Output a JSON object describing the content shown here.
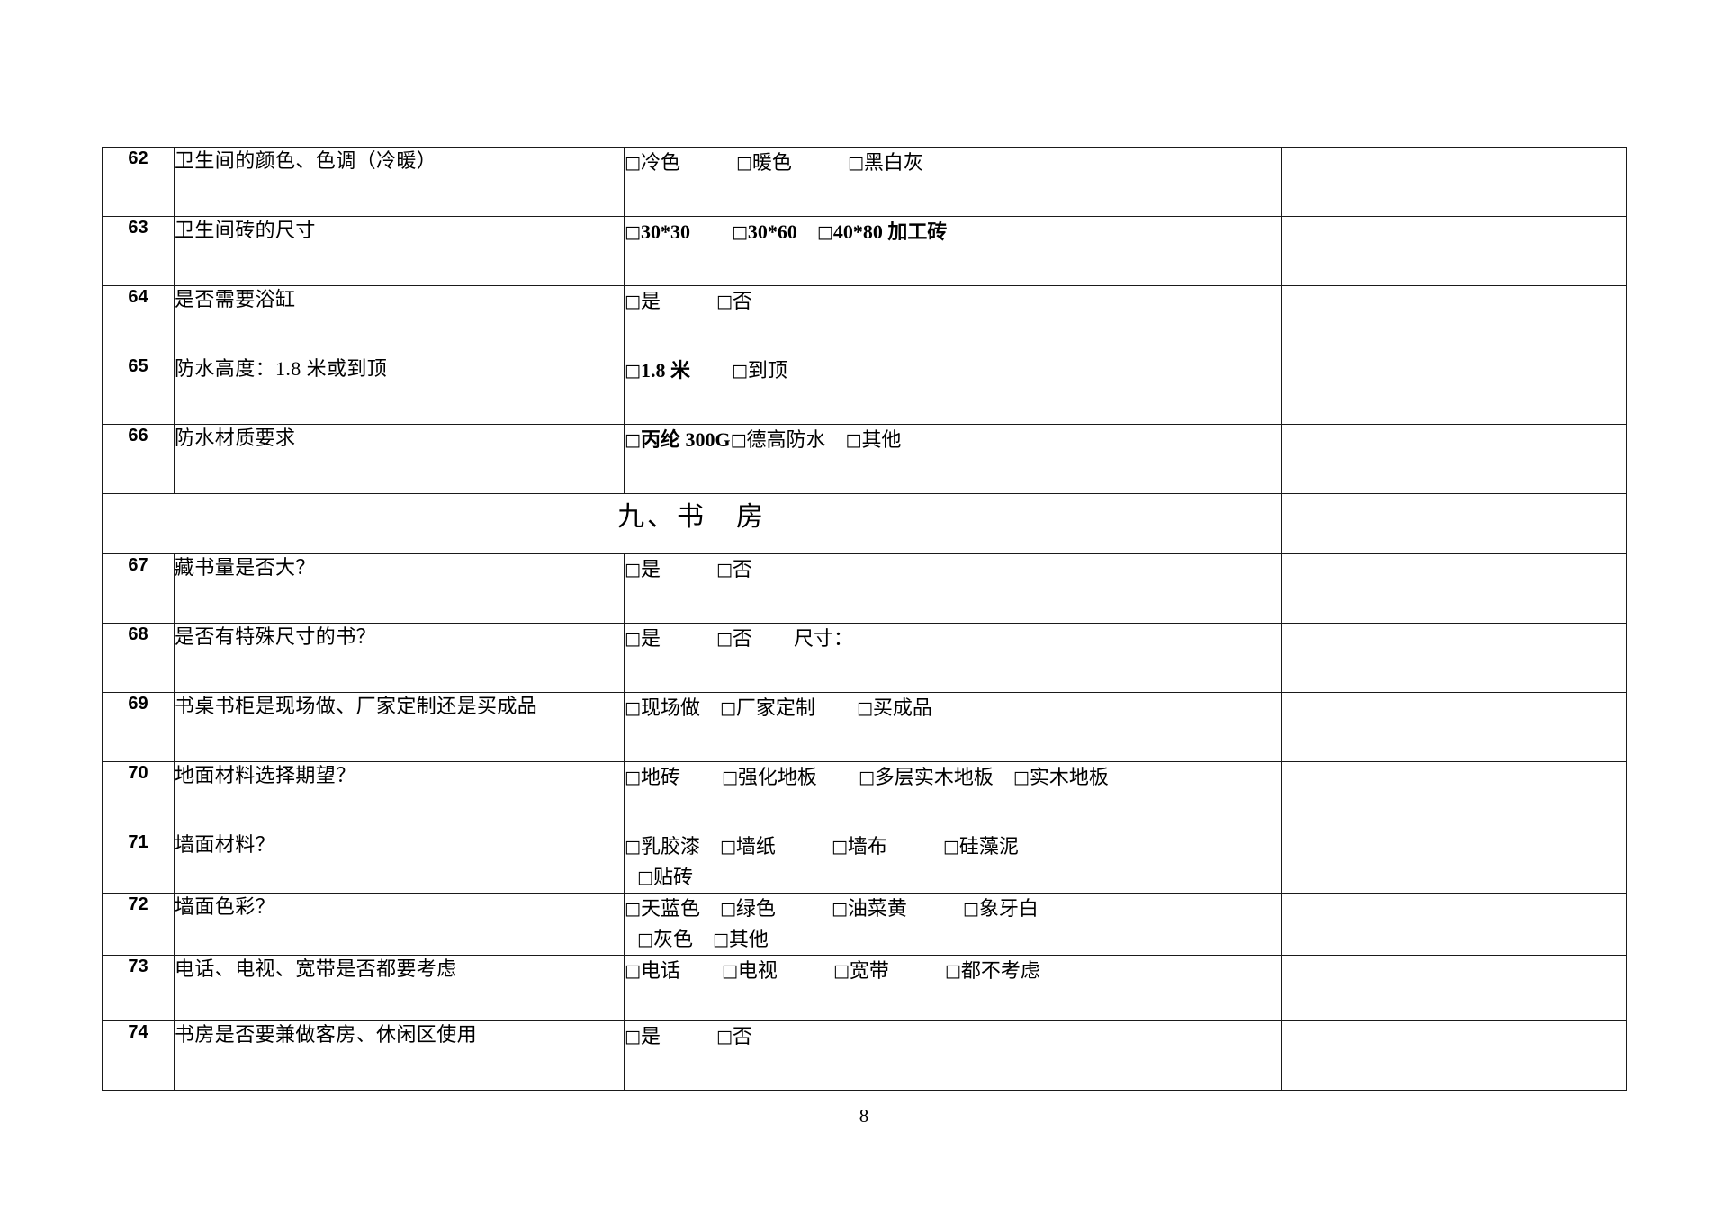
{
  "document": {
    "page_number": "8",
    "checkbox_glyph": "□"
  },
  "table": {
    "rows": [
      {
        "kind": "question",
        "number": "62",
        "question": "卫生间的颜色、色调（冷暖）",
        "option_lines": [
          [
            {
              "label": "冷色",
              "bold": false,
              "gap": "lg"
            },
            {
              "label": "暖色",
              "bold": false,
              "gap": "lg"
            },
            {
              "label": "黑白灰",
              "bold": false,
              "gap": "none"
            }
          ]
        ],
        "note": "",
        "height": "tall"
      },
      {
        "kind": "question",
        "number": "63",
        "question": "卫生间砖的尺寸",
        "option_lines": [
          [
            {
              "label": "30*30",
              "bold": true,
              "gap": "md"
            },
            {
              "label": "30*60",
              "bold": true,
              "gap": "sm"
            },
            {
              "label": "40*80 加工砖",
              "bold": true,
              "gap": "none"
            }
          ]
        ],
        "note": "",
        "height": "tall"
      },
      {
        "kind": "question",
        "number": "64",
        "question": "是否需要浴缸",
        "option_lines": [
          [
            {
              "label": "是",
              "bold": false,
              "gap": "lg"
            },
            {
              "label": "否",
              "bold": false,
              "gap": "none"
            }
          ]
        ],
        "note": "",
        "height": "tall"
      },
      {
        "kind": "question",
        "number": "65",
        "question": "防水高度：1.8 米或到顶",
        "option_lines": [
          [
            {
              "label": "1.8 米",
              "bold": true,
              "gap": "md"
            },
            {
              "label": "到顶",
              "bold": false,
              "gap": "none"
            }
          ]
        ],
        "note": "",
        "height": "tall"
      },
      {
        "kind": "question",
        "number": "66",
        "question": "防水材质要求",
        "option_lines": [
          [
            {
              "label": "丙纶 300G",
              "bold": true,
              "gap": "none"
            },
            {
              "label": "德高防水",
              "bold": false,
              "gap": "sm"
            },
            {
              "label": "其他",
              "bold": false,
              "gap": "none"
            }
          ]
        ],
        "note": "",
        "height": "tall"
      },
      {
        "kind": "section",
        "title": "九、书　房",
        "note": ""
      },
      {
        "kind": "question",
        "number": "67",
        "question": "藏书量是否大？",
        "option_lines": [
          [
            {
              "label": "是",
              "bold": false,
              "gap": "lg"
            },
            {
              "label": "否",
              "bold": false,
              "gap": "none"
            }
          ]
        ],
        "note": "",
        "height": "tall"
      },
      {
        "kind": "question",
        "number": "68",
        "question": "是否有特殊尺寸的书？",
        "option_lines": [
          [
            {
              "label": "是",
              "bold": false,
              "gap": "lg"
            },
            {
              "label": "否",
              "bold": false,
              "gap": "plain"
            },
            {
              "label": "尺寸：",
              "bold": false,
              "nobox": true,
              "gap": "none"
            }
          ]
        ],
        "note": "",
        "height": "tall"
      },
      {
        "kind": "question",
        "number": "69",
        "question": "书桌书柜是现场做、厂家定制还是买成品",
        "option_lines": [
          [
            {
              "label": "现场做",
              "bold": false,
              "gap": "sm"
            },
            {
              "label": "厂家定制",
              "bold": false,
              "gap": "md"
            },
            {
              "label": "买成品",
              "bold": false,
              "gap": "none"
            }
          ]
        ],
        "note": "",
        "height": "tall"
      },
      {
        "kind": "question",
        "number": "70",
        "question": "地面材料选择期望？",
        "option_lines": [
          [
            {
              "label": "地砖",
              "bold": false,
              "gap": "md"
            },
            {
              "label": "强化地板",
              "bold": false,
              "gap": "md"
            },
            {
              "label": "多层实木地板",
              "bold": false,
              "gap": "sm"
            },
            {
              "label": "实木地板",
              "bold": false,
              "gap": "none"
            }
          ]
        ],
        "note": "",
        "height": "tall"
      },
      {
        "kind": "question",
        "number": "71",
        "question": "墙面材料？",
        "option_lines": [
          [
            {
              "label": "乳胶漆",
              "bold": false,
              "gap": "sm"
            },
            {
              "label": "墙纸",
              "bold": false,
              "gap": "lg"
            },
            {
              "label": "墙布",
              "bold": false,
              "gap": "lg"
            },
            {
              "label": "硅藻泥",
              "bold": false,
              "gap": "none"
            }
          ],
          [
            {
              "label": "贴砖",
              "bold": false,
              "indent": true,
              "gap": "none"
            }
          ]
        ],
        "note": "",
        "height": "two"
      },
      {
        "kind": "question",
        "number": "72",
        "question": "墙面色彩？",
        "option_lines": [
          [
            {
              "label": "天蓝色",
              "bold": false,
              "gap": "sm"
            },
            {
              "label": "绿色",
              "bold": false,
              "gap": "lg"
            },
            {
              "label": "油菜黄",
              "bold": false,
              "gap": "lg"
            },
            {
              "label": "象牙白",
              "bold": false,
              "gap": "none"
            }
          ],
          [
            {
              "label": "灰色",
              "bold": false,
              "indent": true,
              "gap": "sm"
            },
            {
              "label": "其他",
              "bold": false,
              "gap": "none"
            }
          ]
        ],
        "note": "",
        "height": "two"
      },
      {
        "kind": "question",
        "number": "73",
        "question": "电话、电视、宽带是否都要考虑",
        "option_lines": [
          [
            {
              "label": "电话",
              "bold": false,
              "gap": "md"
            },
            {
              "label": "电视",
              "bold": false,
              "gap": "lg"
            },
            {
              "label": "宽带",
              "bold": false,
              "gap": "lg"
            },
            {
              "label": "都不考虑",
              "bold": false,
              "gap": "none"
            }
          ]
        ],
        "note": "",
        "height": "mid"
      },
      {
        "kind": "question",
        "number": "74",
        "question": "书房是否要兼做客房、休闲区使用",
        "option_lines": [
          [
            {
              "label": "是",
              "bold": false,
              "gap": "lg"
            },
            {
              "label": "否",
              "bold": false,
              "gap": "none"
            }
          ]
        ],
        "note": "",
        "height": "tall"
      }
    ]
  }
}
